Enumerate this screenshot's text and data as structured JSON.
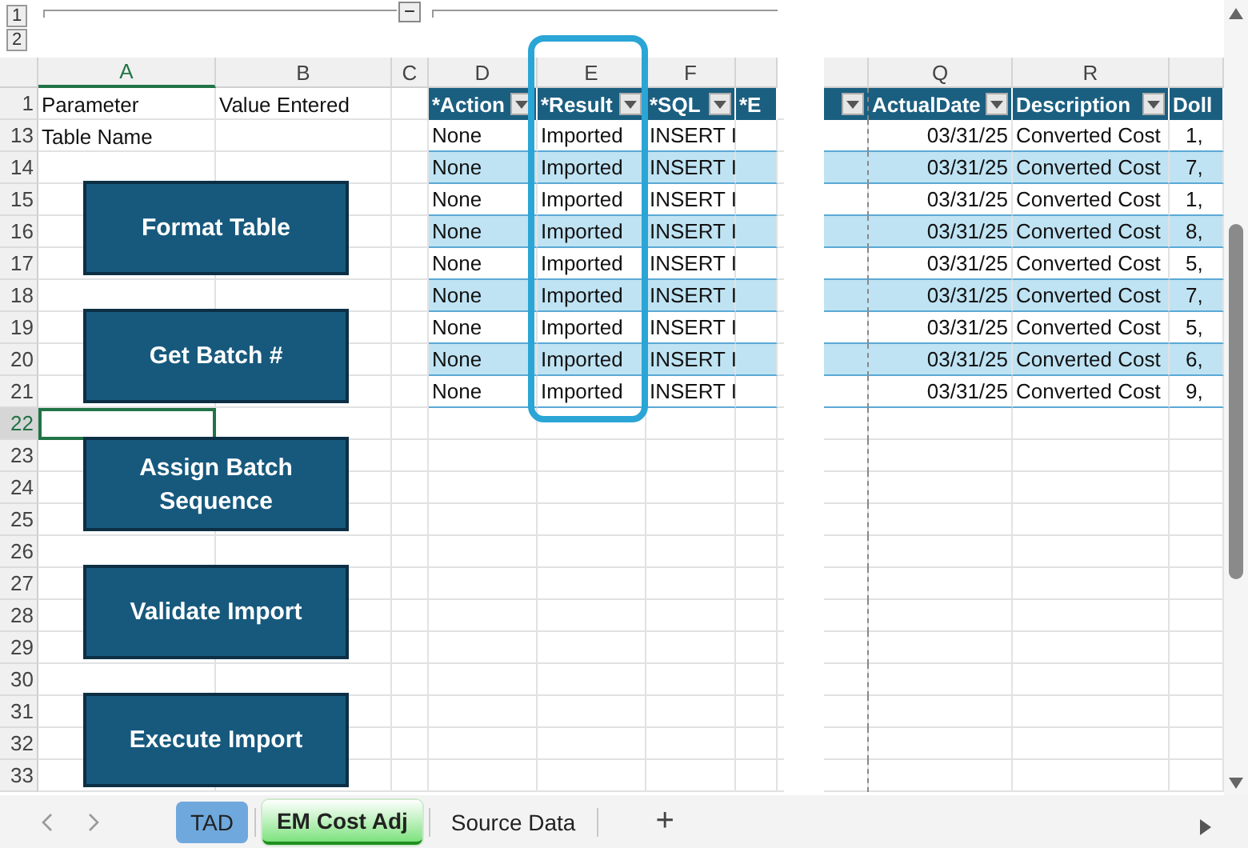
{
  "outline": {
    "levels": [
      "1",
      "2"
    ],
    "toggle": "−"
  },
  "columns": [
    {
      "label": "A",
      "selected": true
    },
    {
      "label": "B",
      "selected": false
    },
    {
      "label": "C",
      "selected": false
    },
    {
      "label": "D",
      "selected": false
    },
    {
      "label": "E",
      "selected": false
    },
    {
      "label": "F",
      "selected": false
    }
  ],
  "right_columns": [
    {
      "label": "Q",
      "selected": false
    },
    {
      "label": "R",
      "selected": false
    }
  ],
  "rows": [
    {
      "label": "1",
      "selected": false
    },
    {
      "label": "13",
      "selected": false
    },
    {
      "label": "14",
      "selected": false
    },
    {
      "label": "15",
      "selected": false
    },
    {
      "label": "16",
      "selected": false
    },
    {
      "label": "17",
      "selected": false
    },
    {
      "label": "18",
      "selected": false
    },
    {
      "label": "19",
      "selected": false
    },
    {
      "label": "20",
      "selected": false
    },
    {
      "label": "21",
      "selected": false
    },
    {
      "label": "22",
      "selected": true
    },
    {
      "label": "23",
      "selected": false
    },
    {
      "label": "24",
      "selected": false
    },
    {
      "label": "25",
      "selected": false
    },
    {
      "label": "26",
      "selected": false
    },
    {
      "label": "27",
      "selected": false
    },
    {
      "label": "28",
      "selected": false
    },
    {
      "label": "29",
      "selected": false
    },
    {
      "label": "30",
      "selected": false
    },
    {
      "label": "31",
      "selected": false
    },
    {
      "label": "32",
      "selected": false
    },
    {
      "label": "33",
      "selected": false
    }
  ],
  "parameter_header": {
    "name": "Parameter",
    "value": "Value Entered"
  },
  "parameters": [
    {
      "name": "Table Name"
    }
  ],
  "table": {
    "headers_left": [
      {
        "label": "*Action",
        "highlighted": false
      },
      {
        "label": "*Result",
        "highlighted": true
      },
      {
        "label": "*SQL",
        "highlighted": false
      },
      {
        "label": "*E",
        "highlighted": false
      }
    ],
    "headers_right": [
      "ActualDate",
      "Description",
      "Doll"
    ],
    "rows": [
      {
        "action": "None",
        "result": "Imported",
        "sql": "INSERT I",
        "actual_date": "03/31/25",
        "description": "Converted Cost",
        "column_s": "1,",
        "banded": false
      },
      {
        "action": "None",
        "result": "Imported",
        "sql": "INSERT I",
        "actual_date": "03/31/25",
        "description": "Converted Cost",
        "column_s": "7,",
        "banded": true
      },
      {
        "action": "None",
        "result": "Imported",
        "sql": "INSERT I",
        "actual_date": "03/31/25",
        "description": "Converted Cost",
        "column_s": "1,",
        "banded": false
      },
      {
        "action": "None",
        "result": "Imported",
        "sql": "INSERT I",
        "actual_date": "03/31/25",
        "description": "Converted Cost",
        "column_s": "8,",
        "banded": true
      },
      {
        "action": "None",
        "result": "Imported",
        "sql": "INSERT I",
        "actual_date": "03/31/25",
        "description": "Converted Cost",
        "column_s": "5,",
        "banded": false
      },
      {
        "action": "None",
        "result": "Imported",
        "sql": "INSERT I",
        "actual_date": "03/31/25",
        "description": "Converted Cost",
        "column_s": "7,",
        "banded": true
      },
      {
        "action": "None",
        "result": "Imported",
        "sql": "INSERT I",
        "actual_date": "03/31/25",
        "description": "Converted Cost",
        "column_s": "5,",
        "banded": false
      },
      {
        "action": "None",
        "result": "Imported",
        "sql": "INSERT I",
        "actual_date": "03/31/25",
        "description": "Converted Cost",
        "column_s": "6,",
        "banded": true
      },
      {
        "action": "None",
        "result": "Imported",
        "sql": "INSERT I",
        "actual_date": "03/31/25",
        "description": "Converted Cost",
        "column_s": "9,",
        "banded": false
      }
    ]
  },
  "buttons": [
    "Format Table",
    "Get Batch #",
    "Assign Batch Sequence",
    "Validate Import",
    "Execute Import"
  ],
  "sheet_tabs": [
    {
      "label": "TAD",
      "selected": false,
      "color": "#6fa8dc"
    },
    {
      "label": "EM Cost Adj",
      "selected": true,
      "color": "#7ee27e"
    },
    {
      "label": "Source Data",
      "selected": false
    }
  ],
  "add_sheet": "+"
}
